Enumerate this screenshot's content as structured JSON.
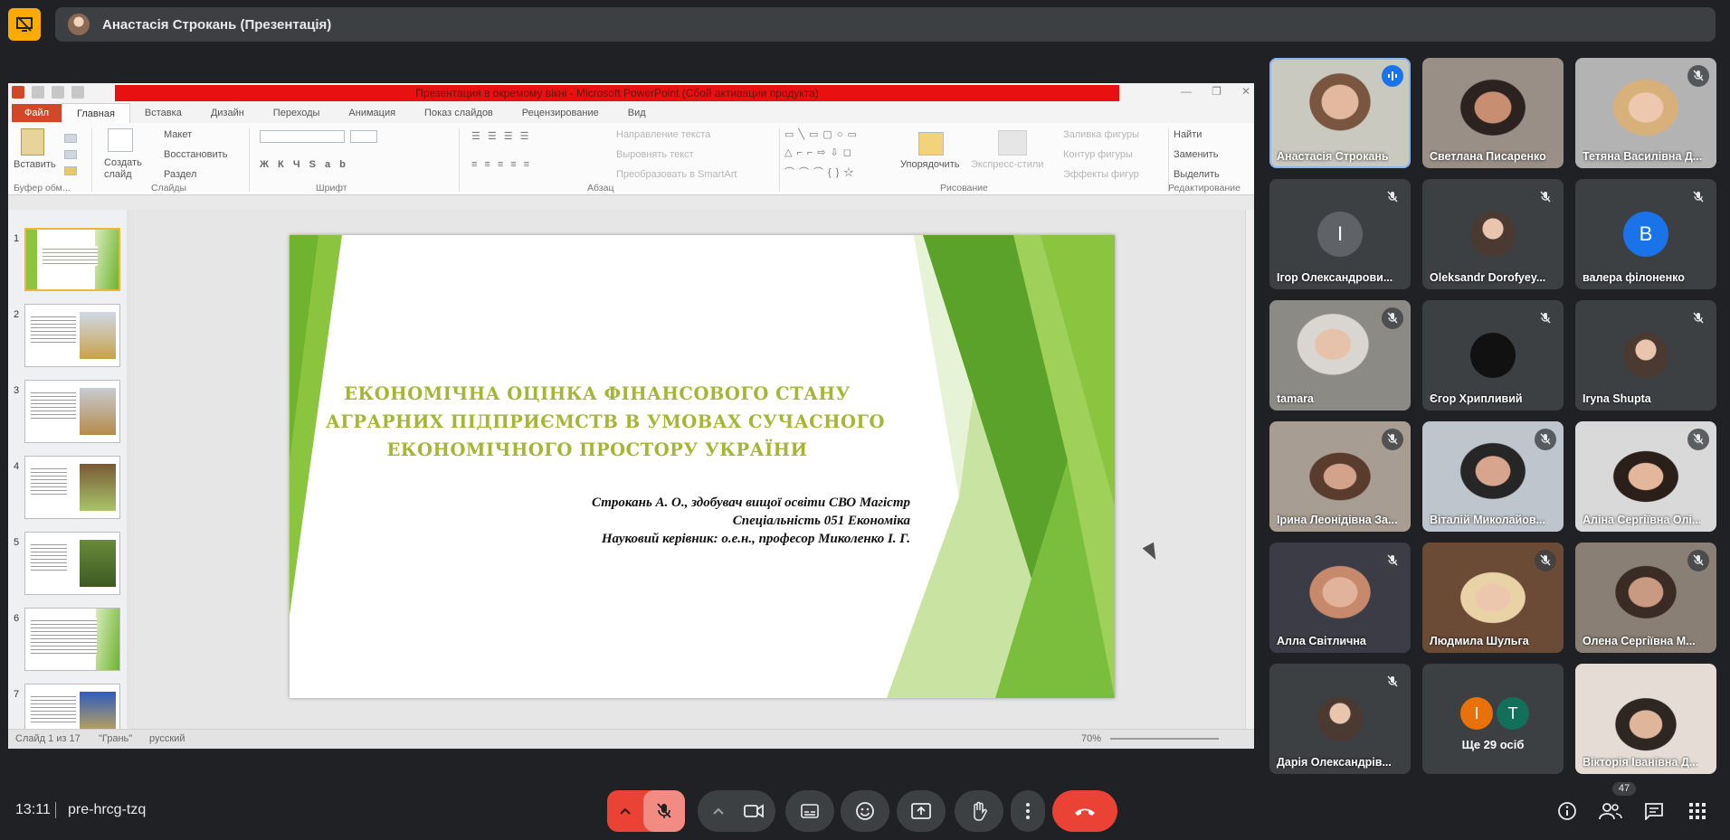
{
  "presenter": {
    "name": "Анастасія Строкань (Презентація)"
  },
  "ppt": {
    "window_title": "Презентация в окремому вікні - Microsoft PowerPoint (Сбой активации продукта)",
    "tabs": [
      "Файл",
      "Главная",
      "Вставка",
      "Дизайн",
      "Переходы",
      "Анимация",
      "Показ слайдов",
      "Рецензирование",
      "Вид"
    ],
    "ribbon": {
      "paste": "Вставить",
      "new_slide": "Создать слайд",
      "layout": "Макет",
      "reset": "Восстановить",
      "section": "Раздел",
      "text_direction": "Направление текста",
      "align_text": "Выровнять текст",
      "smartart": "Преобразовать в SmartArt",
      "arrange": "Упорядочить",
      "quick_styles": "Экспресс-стили",
      "shape_fill": "Заливка фигуры",
      "shape_outline": "Контур фигуры",
      "shape_effects": "Эффекты фигур",
      "find": "Найти",
      "replace": "Заменить",
      "select": "Выделить",
      "group_clipboard": "Буфер обм...",
      "group_slides": "Слайды",
      "group_font": "Шрифт",
      "group_paragraph": "Абзац",
      "group_drawing": "Рисование",
      "group_editing": "Редактирование"
    },
    "thumbnails": [
      "1",
      "2",
      "3",
      "4",
      "5",
      "6",
      "7"
    ],
    "slide": {
      "title_lines": [
        "ЕКОНОМІЧНА ОЦІНКА ФІНАНСОВОГО СТАНУ",
        "АГРАРНИХ ПІДПРИЄМСТВ В УМОВАХ СУЧАСНОГО",
        "ЕКОНОМІЧНОГО ПРОСТОРУ УКРАЇНИ"
      ],
      "sub_lines": [
        "Строкань А. О., здобувач вищої освіти СВО Магістр",
        "Спеціальність 051 Економіка",
        "Науковий керівник: о.е.н., професор Миколенко І. Г."
      ]
    },
    "status": {
      "slide": "Слайд 1 из 17",
      "theme": "\"Грань\"",
      "lang": "русский",
      "zoom": "70%"
    }
  },
  "participants": [
    {
      "name": "Анастасія Строкань",
      "type": "video",
      "speaking": true
    },
    {
      "name": "Светлана Писаренко",
      "type": "video"
    },
    {
      "name": "Тетяна Василівна Д...",
      "type": "video",
      "muted": true
    },
    {
      "name": "Ігор Олександрови...",
      "type": "letter",
      "letter": "І",
      "color": "#5f6368",
      "muted": true
    },
    {
      "name": "Oleksandr Dorofyey...",
      "type": "photo",
      "muted": true
    },
    {
      "name": "валера філоненко",
      "type": "letter",
      "letter": "B",
      "color": "#1a73e8",
      "muted": true
    },
    {
      "name": "tamara",
      "type": "video",
      "muted": true
    },
    {
      "name": "Єгор Хрипливий",
      "type": "letter",
      "letter": "",
      "color": "#111111",
      "muted": true
    },
    {
      "name": "Iryna Shupta",
      "type": "photo",
      "muted": true
    },
    {
      "name": "Ірина Леонідівна За...",
      "type": "video",
      "muted": true
    },
    {
      "name": "Віталій Миколайов...",
      "type": "video",
      "muted": true
    },
    {
      "name": "Аліна Сергіївна Олі...",
      "type": "video",
      "muted": true
    },
    {
      "name": "Алла Світлична",
      "type": "video",
      "muted": true
    },
    {
      "name": "Людмила Шульга",
      "type": "video",
      "muted": true
    },
    {
      "name": "Олена Сергіївна М...",
      "type": "video",
      "muted": true
    },
    {
      "name": "Дарія Олександрів...",
      "type": "photo",
      "muted": true
    },
    {
      "name": "Ще 29 осіб",
      "type": "more"
    },
    {
      "name": "Вікторія Іванівна Д...",
      "type": "video"
    }
  ],
  "more_avatars": [
    "І",
    "Т"
  ],
  "footer": {
    "time": "13:11",
    "meeting_code": "pre-hrcg-tzq",
    "people_count": "47"
  },
  "colors": {
    "background": "#202124",
    "tile": "#3c4043",
    "danger": "#ea4335",
    "accent": "#8ab4f8",
    "logo": "#f9ab00"
  }
}
